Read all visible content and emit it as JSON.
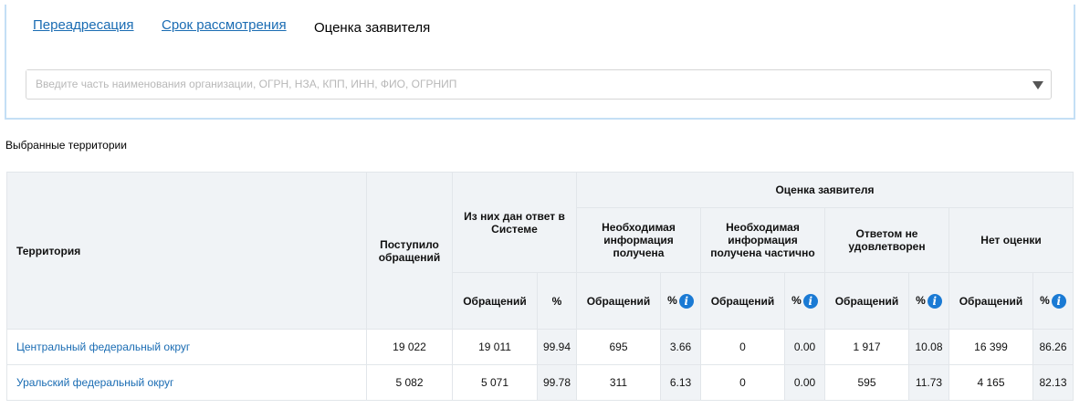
{
  "tabs": [
    "Переадресация",
    "Срок рассмотрения",
    "Оценка заявителя"
  ],
  "search": {
    "placeholder": "Введите часть наименования организации, ОГРН, НЗА, КПП, ИНН, ФИО, ОГРНИП"
  },
  "selected_label": "Выбранные территории",
  "table": {
    "h_territory": "Территория",
    "h_received": "Поступило обращений",
    "h_answered": "Из них дан ответ в Системе",
    "h_rating": "Оценка заявителя",
    "groups": [
      "Необходимая информация получена",
      "Необходимая информация получена частично",
      "Ответом не удовлетворен",
      "Нет оценки"
    ],
    "sub_count": "Обращений",
    "sub_pct": "%",
    "rows": [
      [
        "Центральный федеральный округ",
        "19 022",
        "19 011",
        "99.94",
        "695",
        "3.66",
        "0",
        "0.00",
        "1 917",
        "10.08",
        "16 399",
        "86.26"
      ],
      [
        "Уральский федеральный округ",
        "5 082",
        "5 071",
        "99.78",
        "311",
        "6.13",
        "0",
        "0.00",
        "595",
        "11.73",
        "4 165",
        "82.13"
      ]
    ]
  },
  "colors": {
    "accent": "#1a6cb3",
    "tabbar": "#c4dff5",
    "header": "#f0f3f6"
  }
}
